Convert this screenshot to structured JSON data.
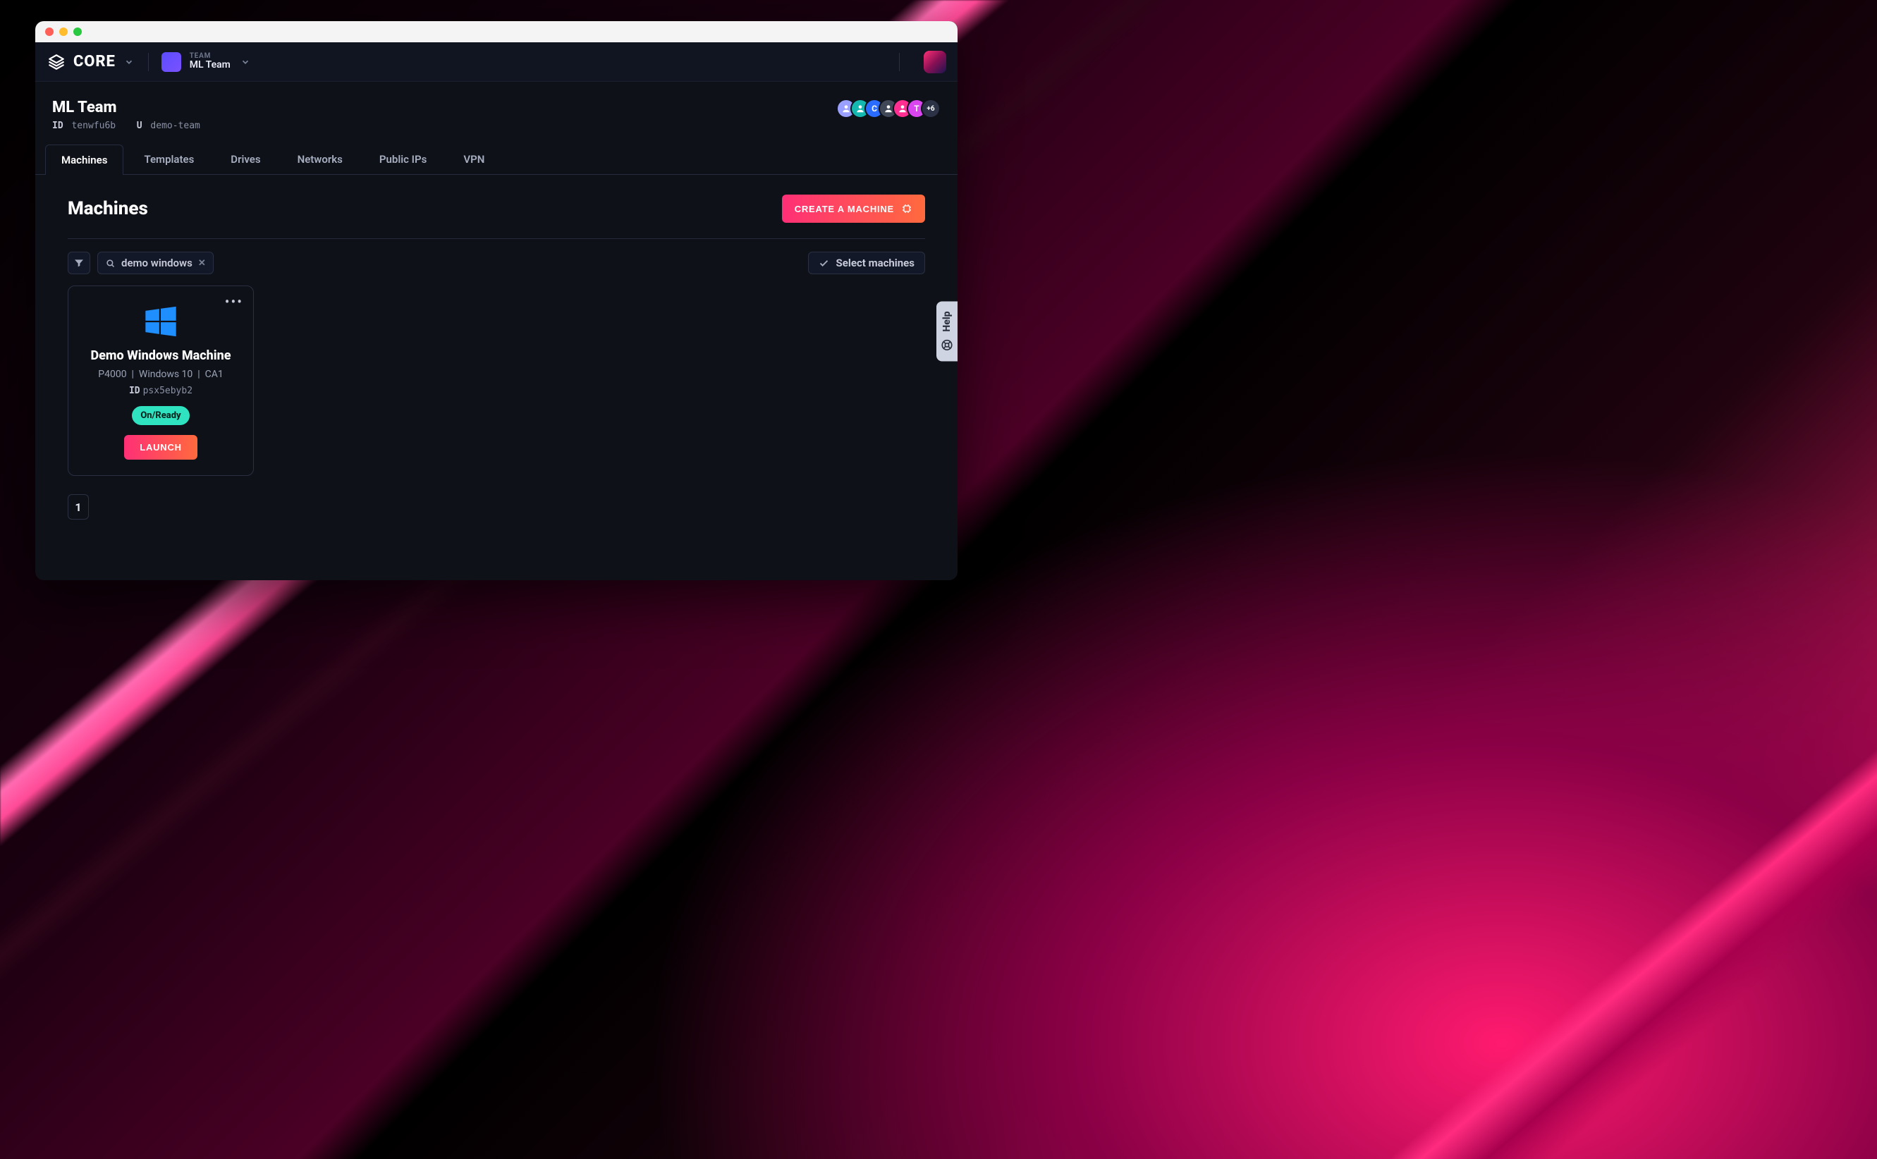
{
  "brand": {
    "name": "CORE"
  },
  "team_picker": {
    "label": "TEAM",
    "name": "ML Team"
  },
  "page": {
    "title": "ML Team",
    "id_label": "ID",
    "id_value": "tenwfu6b",
    "u_label": "U",
    "u_value": "demo-team"
  },
  "avatars": [
    {
      "bg": "#9aa0ff",
      "text": ""
    },
    {
      "bg": "#15b8b0",
      "text": ""
    },
    {
      "bg": "#2a6cff",
      "text": "C"
    },
    {
      "bg": "#404756",
      "text": ""
    },
    {
      "bg": "#ff2f92",
      "text": ""
    },
    {
      "bg": "#d946ef",
      "text": "T"
    }
  ],
  "avatars_more": "+6",
  "tabs": [
    {
      "label": "Machines",
      "active": true
    },
    {
      "label": "Templates"
    },
    {
      "label": "Drives"
    },
    {
      "label": "Networks"
    },
    {
      "label": "Public IPs"
    },
    {
      "label": "VPN"
    }
  ],
  "section": {
    "title": "Machines",
    "cta": "CREATE A MACHINE"
  },
  "filter_chip": "demo windows",
  "select_btn": "Select machines",
  "machines": [
    {
      "name": "Demo Windows Machine",
      "spec": "P4000",
      "os": "Windows 10",
      "region": "CA1",
      "id_label": "ID",
      "id_value": "psx5ebyb2",
      "status": "On/Ready",
      "launch": "LAUNCH"
    }
  ],
  "pagination": {
    "current": "1"
  },
  "help": "Help"
}
